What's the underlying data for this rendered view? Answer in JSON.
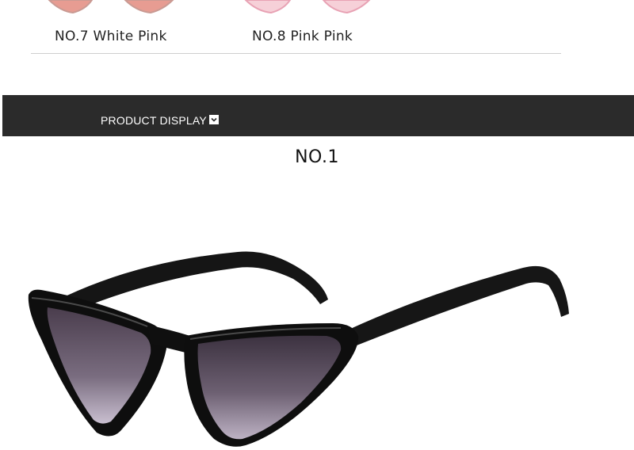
{
  "variants": [
    {
      "label": "NO.7 White Pink",
      "lens_color": "#e79c92"
    },
    {
      "label": "NO.8 Pink Pink",
      "lens_color": "#f2b5c3"
    }
  ],
  "banner": {
    "title": "PRODUCT DISPLAY",
    "icon": "chevron-down-icon",
    "background": "#2b2b2b"
  },
  "section": {
    "title": "NO.1"
  },
  "product": {
    "frame_color": "#111111",
    "lens_color": "#5b4a5c"
  }
}
